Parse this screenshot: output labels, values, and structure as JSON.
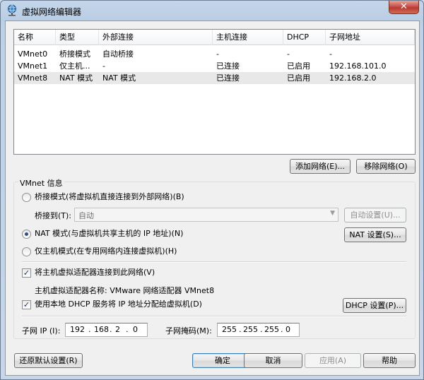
{
  "window": {
    "title": "虚拟网络编辑器",
    "close_glyph": "✕"
  },
  "table": {
    "columns": [
      "名称",
      "类型",
      "外部连接",
      "主机连接",
      "DHCP",
      "子网地址"
    ],
    "rows": [
      {
        "name": "VMnet0",
        "type": "桥接模式",
        "external": "自动桥接",
        "host": "-",
        "dhcp": "-",
        "subnet": "-"
      },
      {
        "name": "VMnet1",
        "type": "仅主机...",
        "external": "-",
        "host": "已连接",
        "dhcp": "已启用",
        "subnet": "192.168.101.0"
      },
      {
        "name": "VMnet8",
        "type": "NAT 模式",
        "external": "NAT 模式",
        "host": "已连接",
        "dhcp": "已启用",
        "subnet": "192.168.2.0"
      }
    ],
    "selected_row": 2
  },
  "buttons": {
    "add_network": "添加网络(E)...",
    "remove_network": "移除网络(O)",
    "auto_settings": "自动设置(U)...",
    "nat_settings": "NAT 设置(S)...",
    "dhcp_settings": "DHCP 设置(P)...",
    "restore_defaults": "还原默认设置(R)",
    "ok": "确定",
    "cancel": "取消",
    "apply": "应用(A)",
    "help": "帮助"
  },
  "vmnet_info": {
    "group_title": "VMnet 信息",
    "bridge_mode": "桥接模式(将虚拟机直接连接到外部网络)(B)",
    "bridge_to_label": "桥接到(T):",
    "bridge_to_value": "自动",
    "nat_mode": "NAT 模式(与虚拟机共享主机的 IP 地址)(N)",
    "host_only_mode": "仅主机模式(在专用网络内连接虚拟机)(H)",
    "selected_mode": "nat",
    "connect_adapter": "将主机虚拟适配器连接到此网络(V)",
    "connect_adapter_checked": true,
    "adapter_name_text": "主机虚拟适配器名称: VMware 网络适配器 VMnet8",
    "use_dhcp": "使用本地 DHCP 服务将 IP 地址分配给虚拟机(D)",
    "use_dhcp_checked": true,
    "subnet_ip_label": "子网 IP (I):",
    "subnet_ip": [
      "192",
      "168",
      "2",
      "0"
    ],
    "subnet_mask_label": "子网掩码(M):",
    "subnet_mask": [
      "255",
      "255",
      "255",
      "0"
    ],
    "dot": "."
  },
  "colors": {
    "title_bg": "#c5d6ea",
    "close_button": "#c75050",
    "selected_row": "#e8e8e8"
  }
}
